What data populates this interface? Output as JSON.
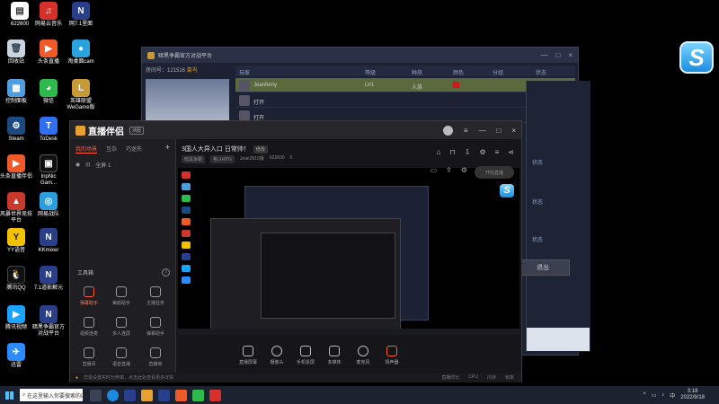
{
  "desktop": {
    "icons": [
      {
        "label": "622600",
        "color": "#ffffff"
      },
      {
        "label": "网易云音乐",
        "color": "#d6302a"
      },
      {
        "label": "网7.1里面",
        "color": "#2a3f8c"
      },
      {
        "label": "回收站",
        "color": "#c9d4e0"
      },
      {
        "label": "头条直播",
        "color": "#f05a28"
      },
      {
        "label": "淘桌面cam",
        "color": "#29a3e0"
      },
      {
        "label": "控制面板",
        "color": "#4f9fe0"
      },
      {
        "label": "微信",
        "color": "#2dbb4e"
      },
      {
        "label": "英雄联盟WeGame版",
        "color": "#c79a35"
      },
      {
        "label": "Steam",
        "color": "#1b4a80"
      },
      {
        "label": "ToDesk",
        "color": "#2f6ff2"
      },
      {
        "label": "直播伴侣",
        "color": "#222222"
      },
      {
        "label": "头条直播伴侣",
        "color": "#f05a28"
      },
      {
        "label": "InpNic Gam...",
        "color": "#111111"
      },
      {
        "label": "风暴世界竞技平台",
        "color": "#c8392b"
      },
      {
        "label": "网易战队",
        "color": "#2b9ee0"
      },
      {
        "label": "YY语音",
        "color": "#f2c200"
      },
      {
        "label": "KKmixer",
        "color": "#2a3f8c"
      },
      {
        "label": "腾讯QQ",
        "color": "#111111"
      },
      {
        "label": "7.1道影解元",
        "color": "#2a3f8c"
      },
      {
        "label": "腾讯视频",
        "color": "#1aa3ff"
      },
      {
        "label": "暗黑争霸官方对战平台",
        "color": "#2a3f8c"
      },
      {
        "label": "迅雷",
        "color": "#2b8cff"
      }
    ]
  },
  "platform_window": {
    "title": "暗黑争霸官方对战平台",
    "room_label": "房间号：121516",
    "room_tag": "菜鸟",
    "headers": [
      "玩家",
      "等级",
      "种族",
      "颜色",
      "分组",
      "状态"
    ],
    "rows": [
      {
        "name": "Jeanfemy",
        "level": "LV1",
        "race": "人族",
        "color": "#d01818"
      },
      {
        "name": "打开",
        "level": "",
        "race": "",
        "color": ""
      },
      {
        "name": "打开",
        "level": "",
        "race": "",
        "color": ""
      }
    ],
    "side_labels": [
      "状态",
      "状态",
      "状态"
    ],
    "exit_label": "退出",
    "win_buttons": [
      "—",
      "□",
      "×"
    ]
  },
  "live_window": {
    "app_name": "直播伴侣",
    "badge": "测服",
    "top_icons": [
      "gift-icon",
      "lock-icon",
      "download-icon",
      "settings-icon",
      "menu-icon",
      "share-icon"
    ],
    "tabs": [
      "我的场景",
      "互杂",
      "巧迷失"
    ],
    "scene_label": "全屏 1",
    "tools_title": "工具箱",
    "tools": [
      {
        "label": "弹幕助手"
      },
      {
        "label": "美颜助手"
      },
      {
        "label": "主播任务"
      },
      {
        "label": "视频连麦"
      },
      {
        "label": "多人连屏"
      },
      {
        "label": "弹幕助手"
      },
      {
        "label": "直播间"
      },
      {
        "label": "语音直播"
      },
      {
        "label": "直播商"
      }
    ],
    "stream_title": "3国人大异入口 日常帅！",
    "edit_label": "修改",
    "stream_tags": [
      "暗黑争霸",
      "格斗RPG",
      "Jean2610版",
      "622600"
    ],
    "viewers": "0",
    "controls": [
      "直播屏幕",
      "摄像头",
      "手机投屏",
      "多媒体",
      "麦克风",
      "扬声器"
    ],
    "go_live": "开始直播",
    "status_warn": "您需设置实时分辨率，点击此处查看更多详情",
    "stats": [
      "直播时长",
      "CPU",
      "内存",
      "帧率"
    ]
  },
  "taskbar": {
    "search": "在这里输入你要搜索的内容",
    "time": "3:18",
    "date": "2022/9/18"
  }
}
